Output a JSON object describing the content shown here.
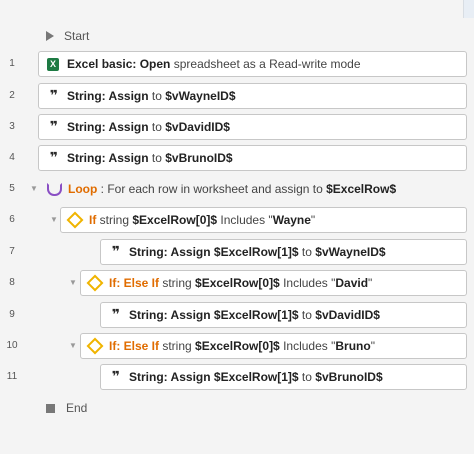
{
  "start_label": "Start",
  "end_label": "End",
  "steps": [
    {
      "num": "1",
      "parts": [
        "Excel basic: Open",
        " spreadsheet as a Read-write mode"
      ],
      "icon": "excel-icon"
    },
    {
      "num": "2",
      "parts": [
        "String: Assign",
        " to ",
        "$vWayneID$"
      ],
      "icon": "quote-icon"
    },
    {
      "num": "3",
      "parts": [
        "String: Assign",
        " to ",
        "$vDavidID$"
      ],
      "icon": "quote-icon"
    },
    {
      "num": "4",
      "parts": [
        "String: Assign",
        " to ",
        "$vBrunoID$"
      ],
      "icon": "quote-icon"
    },
    {
      "num": "5",
      "parts": [
        "Loop",
        " : For each row in worksheet and assign to ",
        "$ExcelRow$"
      ],
      "icon": "loop-icon"
    },
    {
      "num": "6",
      "parts": [
        "If",
        " string ",
        "$ExcelRow[0]$",
        " Includes \"",
        "Wayne",
        "\""
      ],
      "icon": "diamond-icon"
    },
    {
      "num": "7",
      "parts": [
        "String: Assign ",
        "$ExcelRow[1]$",
        " to ",
        "$vWayneID$"
      ],
      "icon": "quote-icon"
    },
    {
      "num": "8",
      "parts": [
        "If: Else If",
        " string ",
        "$ExcelRow[0]$",
        " Includes \"",
        "David",
        "\""
      ],
      "icon": "diamond-icon"
    },
    {
      "num": "9",
      "parts": [
        "String: Assign ",
        "$ExcelRow[1]$",
        " to ",
        "$vDavidID$"
      ],
      "icon": "quote-icon"
    },
    {
      "num": "10",
      "parts": [
        "If: Else If",
        " string ",
        "$ExcelRow[0]$",
        " Includes \"",
        "Bruno",
        "\""
      ],
      "icon": "diamond-icon"
    },
    {
      "num": "11",
      "parts": [
        "String: Assign ",
        "$ExcelRow[1]$",
        " to ",
        "$vBrunoID$"
      ],
      "icon": "quote-icon"
    }
  ]
}
